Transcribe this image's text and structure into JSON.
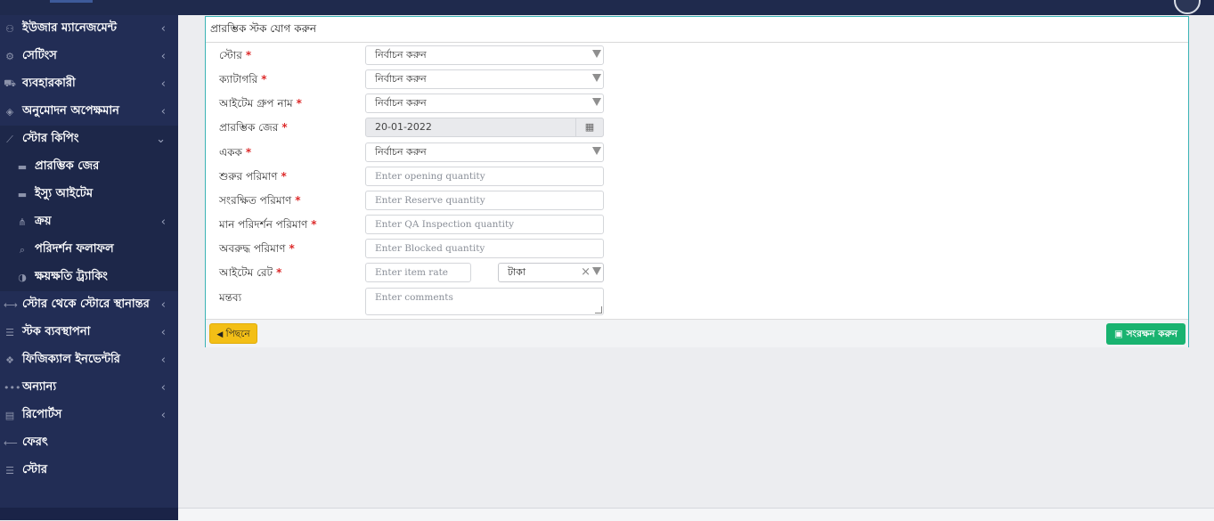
{
  "sidebar": {
    "items": [
      {
        "icon": "user-icon",
        "glyph": "⚇",
        "label": "ইউজার ম্যানেজমেন্ট",
        "chevron": "‹"
      },
      {
        "icon": "gears-icon",
        "glyph": "⚙",
        "label": "সেটিংস",
        "chevron": "‹"
      },
      {
        "icon": "cart-icon",
        "glyph": "⛟",
        "label": "ব্যবহারকারী",
        "chevron": "‹"
      },
      {
        "icon": "cube-icon",
        "glyph": "◈",
        "label": "অনুমোদন অপেক্ষমান",
        "chevron": "‹"
      },
      {
        "icon": "chart-line-icon",
        "glyph": "⟋",
        "label": "স্টোর কিপিং",
        "chevron": "⌄"
      }
    ],
    "sub_items": [
      {
        "icon": "folder-open-icon",
        "glyph": "▬",
        "label": "প্রারম্ভিক জের",
        "chevron": ""
      },
      {
        "icon": "folder-open-icon",
        "glyph": "▬",
        "label": "ইস্যু আইটেম",
        "chevron": ""
      },
      {
        "icon": "sitemap-icon",
        "glyph": "⋔",
        "label": "ক্রয়",
        "chevron": "‹"
      },
      {
        "icon": "search-icon",
        "glyph": "⌕",
        "label": "পরিদর্শন ফলাফল",
        "chevron": ""
      },
      {
        "icon": "adjust-icon",
        "glyph": "◑",
        "label": "ক্ষয়ক্ষতি ট্র্যাকিং",
        "chevron": ""
      }
    ],
    "more_items": [
      {
        "icon": "exchange-icon",
        "glyph": "⟷",
        "label": "স্টোর থেকে স্টোরে স্থানান্তর",
        "chevron": "‹"
      },
      {
        "icon": "sliders-icon",
        "glyph": "☰",
        "label": "স্টক ব্যবস্থাপনা",
        "chevron": "‹"
      },
      {
        "icon": "cubes-icon",
        "glyph": "❖",
        "label": "ফিজিক্যাল ইনভেন্টরি",
        "chevron": "‹"
      },
      {
        "icon": "ellipsis-icon",
        "glyph": "•••",
        "label": "অন্যান্য",
        "chevron": "‹"
      },
      {
        "icon": "book-icon",
        "glyph": "▤",
        "label": "রিপোর্টস",
        "chevron": "‹"
      },
      {
        "icon": "arrow-left-icon",
        "glyph": "⟵",
        "label": "ফেরৎ",
        "chevron": ""
      },
      {
        "icon": "sliders-icon",
        "glyph": "☰",
        "label": "স্টোর",
        "chevron": ""
      }
    ]
  },
  "form": {
    "title": "প্রারম্ভিক স্টক যোগ করুন",
    "required_mark": "*",
    "store": {
      "label": "স্টোর",
      "value": "নির্বাচন করুন"
    },
    "category": {
      "label": "ক্যাটাগরি",
      "value": "নির্বাচন করুন"
    },
    "item_group": {
      "label": "আইটেম গ্রুপ নাম",
      "value": "নির্বাচন করুন"
    },
    "opening_balance": {
      "label": "প্রারম্ভিক জের",
      "value": "20-01-2022",
      "icon": "calendar-icon",
      "icon_glyph": "▦"
    },
    "unit": {
      "label": "একক",
      "value": "নির্বাচন করুন"
    },
    "opening_qty": {
      "label": "শুরুর পরিমাণ",
      "placeholder": "Enter opening quantity"
    },
    "reserve_qty": {
      "label": "সংরক্ষিত পরিমাণ",
      "placeholder": "Enter Reserve quantity"
    },
    "qa_qty": {
      "label": "মান পরিদর্শন পরিমাণ",
      "placeholder": "Enter QA Inspection quantity"
    },
    "blocked_qty": {
      "label": "অবরুদ্ধ পরিমাণ",
      "placeholder": "Enter Blocked quantity"
    },
    "item_rate": {
      "label": "আইটেম রেট",
      "placeholder": "Enter item rate",
      "currency": "টাকা",
      "clear_glyph": "×"
    },
    "comments": {
      "label": "মন্তব্য",
      "placeholder": "Enter comments"
    }
  },
  "buttons": {
    "back": {
      "label": "পিছনে",
      "icon": "arrow-circle-left-icon",
      "glyph": "◀"
    },
    "save": {
      "label": "সংরক্ষন করুন",
      "icon": "save-icon",
      "glyph": "▣"
    }
  },
  "colors": {
    "sidebar_bg": "#222d55",
    "topbar_bg": "#1f2a4d",
    "panel_border": "#3ab3b5",
    "required": "#dd2b2b",
    "back_button": "#f3bf16",
    "save_button": "#19b370"
  }
}
